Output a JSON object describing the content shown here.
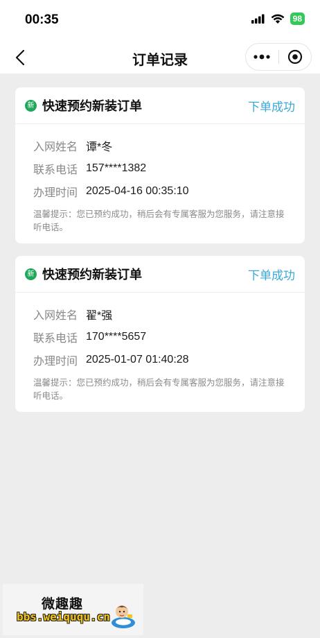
{
  "status_bar": {
    "time": "00:35",
    "battery": "98"
  },
  "nav": {
    "title": "订单记录"
  },
  "orders": [
    {
      "badge": "新",
      "title": "快速预约新装订单",
      "status": "下单成功",
      "name_label": "入网姓名",
      "name_value": "谭*冬",
      "phone_label": "联系电话",
      "phone_value": "157****1382",
      "time_label": "办理时间",
      "time_value": "2025-04-16 00:35:10",
      "tip": "温馨提示：您已预约成功，稍后会有专属客服为您服务，请注意接听电话。"
    },
    {
      "badge": "新",
      "title": "快速预约新装订单",
      "status": "下单成功",
      "name_label": "入网姓名",
      "name_value": "翟*强",
      "phone_label": "联系电话",
      "phone_value": "170****5657",
      "time_label": "办理时间",
      "time_value": "2025-01-07 01:40:28",
      "tip": "温馨提示：您已预约成功，稍后会有专属客服为您服务，请注意接听电话。"
    }
  ],
  "watermark": {
    "logo_text": "微趣趣",
    "url": "bbs.weiququ.cn"
  }
}
